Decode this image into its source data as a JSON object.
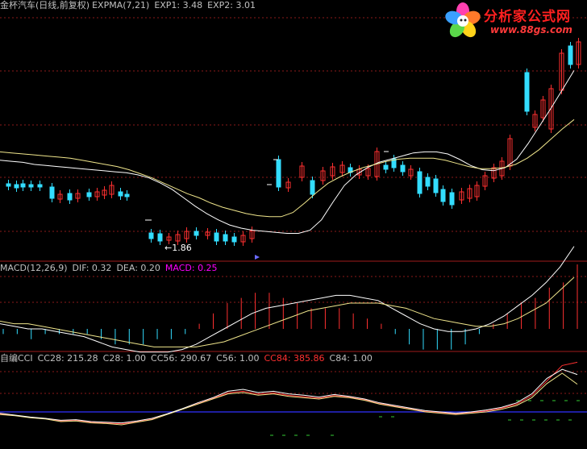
{
  "price_panel": {
    "title": "金杯汽车(日线,前复权)",
    "indicator": "EXPMA(7,21)",
    "exp1_label": "EXP1: 3.48",
    "exp2_label": "EXP2: 3.01",
    "low_label": "←1.86"
  },
  "macd_panel": {
    "title": "MACD(12,26,9)",
    "dif_label": "DIF: 0.32",
    "dea_label": "DEA: 0.20",
    "macd_label": "MACD: 0.25"
  },
  "cci_panel": {
    "title": "自编CCI",
    "cc28_label": "CC28: 215.28",
    "c28_label": "C28: 1.00",
    "cc56_label": "CC56: 290.67",
    "c56_label": "C56: 1.00",
    "cc84_label": "CC84: 385.86",
    "c84_label": "C84: 1.00"
  },
  "logo": {
    "title": "分析家公式网",
    "url": "www.88gs.com"
  },
  "colors": {
    "up": "#ff3030",
    "down": "#33ddff",
    "ma": "#ffffff",
    "grid": "#8b1a1a",
    "title": "#c0c0c0",
    "macd_label": "#ff00ff",
    "cc84_label": "#ff3030",
    "cci_base": "#3030ff"
  },
  "chart_data": [
    {
      "type": "candlestick",
      "title": "金杯汽车(日线,前复权)",
      "series": [
        {
          "name": "EXP1",
          "values": [
            2.62,
            2.61,
            2.6,
            2.58,
            2.57,
            2.56,
            2.55,
            2.54,
            2.53,
            2.52,
            2.51,
            2.5,
            2.48,
            2.45,
            2.4,
            2.34,
            2.26,
            2.18,
            2.11,
            2.05,
            2.0,
            1.97,
            1.95,
            1.94,
            1.93,
            1.92,
            1.92,
            1.95,
            2.05,
            2.22,
            2.38,
            2.48,
            2.55,
            2.6,
            2.63,
            2.66,
            2.69,
            2.7,
            2.7,
            2.68,
            2.63,
            2.57,
            2.53,
            2.52,
            2.55,
            2.63,
            2.78,
            2.95,
            3.12,
            3.3,
            3.48
          ]
        },
        {
          "name": "EXP2",
          "values": [
            2.7,
            2.69,
            2.68,
            2.67,
            2.66,
            2.65,
            2.64,
            2.62,
            2.6,
            2.58,
            2.56,
            2.53,
            2.49,
            2.45,
            2.4,
            2.35,
            2.3,
            2.26,
            2.21,
            2.17,
            2.14,
            2.11,
            2.09,
            2.08,
            2.08,
            2.12,
            2.21,
            2.31,
            2.4,
            2.46,
            2.51,
            2.55,
            2.58,
            2.61,
            2.63,
            2.64,
            2.64,
            2.64,
            2.62,
            2.59,
            2.56,
            2.54,
            2.54,
            2.55,
            2.58,
            2.64,
            2.72,
            2.82,
            2.92,
            3.01
          ]
        }
      ],
      "low_marker": 1.86,
      "ylim": [
        1.7,
        4.0
      ]
    },
    {
      "type": "bar",
      "title": "MACD(12,26,9)",
      "series": [
        {
          "name": "DIF",
          "values": [
            0.02,
            0.01,
            0.0,
            0.0,
            -0.01,
            -0.02,
            -0.03,
            -0.05,
            -0.07,
            -0.08,
            -0.09,
            -0.09,
            -0.09,
            -0.08,
            -0.06,
            -0.03,
            0.0,
            0.03,
            0.06,
            0.08,
            0.09,
            0.1,
            0.11,
            0.12,
            0.13,
            0.13,
            0.12,
            0.11,
            0.08,
            0.05,
            0.02,
            0.0,
            -0.01,
            -0.01,
            0.0,
            0.02,
            0.05,
            0.09,
            0.13,
            0.18,
            0.24,
            0.32
          ]
        },
        {
          "name": "DEA",
          "values": [
            0.03,
            0.02,
            0.02,
            0.01,
            0.0,
            -0.01,
            -0.02,
            -0.03,
            -0.04,
            -0.05,
            -0.06,
            -0.07,
            -0.07,
            -0.07,
            -0.07,
            -0.06,
            -0.05,
            -0.03,
            -0.01,
            0.01,
            0.03,
            0.05,
            0.07,
            0.08,
            0.09,
            0.1,
            0.1,
            0.1,
            0.09,
            0.08,
            0.06,
            0.04,
            0.03,
            0.02,
            0.01,
            0.01,
            0.02,
            0.04,
            0.07,
            0.1,
            0.15,
            0.2
          ]
        },
        {
          "name": "MACD",
          "values": [
            -0.02,
            -0.02,
            -0.04,
            -0.02,
            -0.02,
            -0.02,
            -0.02,
            -0.04,
            -0.06,
            -0.06,
            -0.06,
            -0.04,
            -0.04,
            -0.02,
            0.02,
            0.06,
            0.1,
            0.12,
            0.14,
            0.14,
            0.12,
            0.1,
            0.08,
            0.08,
            0.08,
            0.06,
            0.04,
            0.02,
            -0.02,
            -0.06,
            -0.08,
            -0.08,
            -0.08,
            -0.06,
            -0.02,
            0.02,
            0.06,
            0.1,
            0.12,
            0.16,
            0.18,
            0.25
          ]
        }
      ]
    },
    {
      "type": "line",
      "title": "自编CCI",
      "series": [
        {
          "name": "CC28",
          "values": [
            -20,
            -30,
            -45,
            -55,
            -75,
            -70,
            -85,
            -90,
            -100,
            -80,
            -60,
            -20,
            20,
            60,
            100,
            140,
            150,
            130,
            140,
            120,
            110,
            100,
            120,
            110,
            90,
            60,
            40,
            20,
            0,
            -10,
            -20,
            -10,
            0,
            20,
            50,
            110,
            220,
            300,
            215
          ]
        },
        {
          "name": "CC56",
          "values": [
            -10,
            -25,
            -40,
            -50,
            -65,
            -60,
            -75,
            -80,
            -85,
            -70,
            -50,
            -15,
            25,
            70,
            110,
            160,
            175,
            150,
            160,
            140,
            130,
            115,
            135,
            120,
            100,
            70,
            50,
            30,
            10,
            0,
            -10,
            0,
            15,
            35,
            70,
            140,
            260,
            330,
            290
          ]
        },
        {
          "name": "CC84",
          "values": [
            -15,
            -28,
            -42,
            -52,
            -70,
            -66,
            -80,
            -86,
            -92,
            -76,
            -56,
            -18,
            22,
            64,
            104,
            148,
            160,
            138,
            148,
            128,
            118,
            106,
            126,
            114,
            94,
            64,
            44,
            24,
            4,
            -6,
            -16,
            -6,
            8,
            28,
            60,
            126,
            240,
            360,
            385
          ]
        }
      ]
    }
  ]
}
